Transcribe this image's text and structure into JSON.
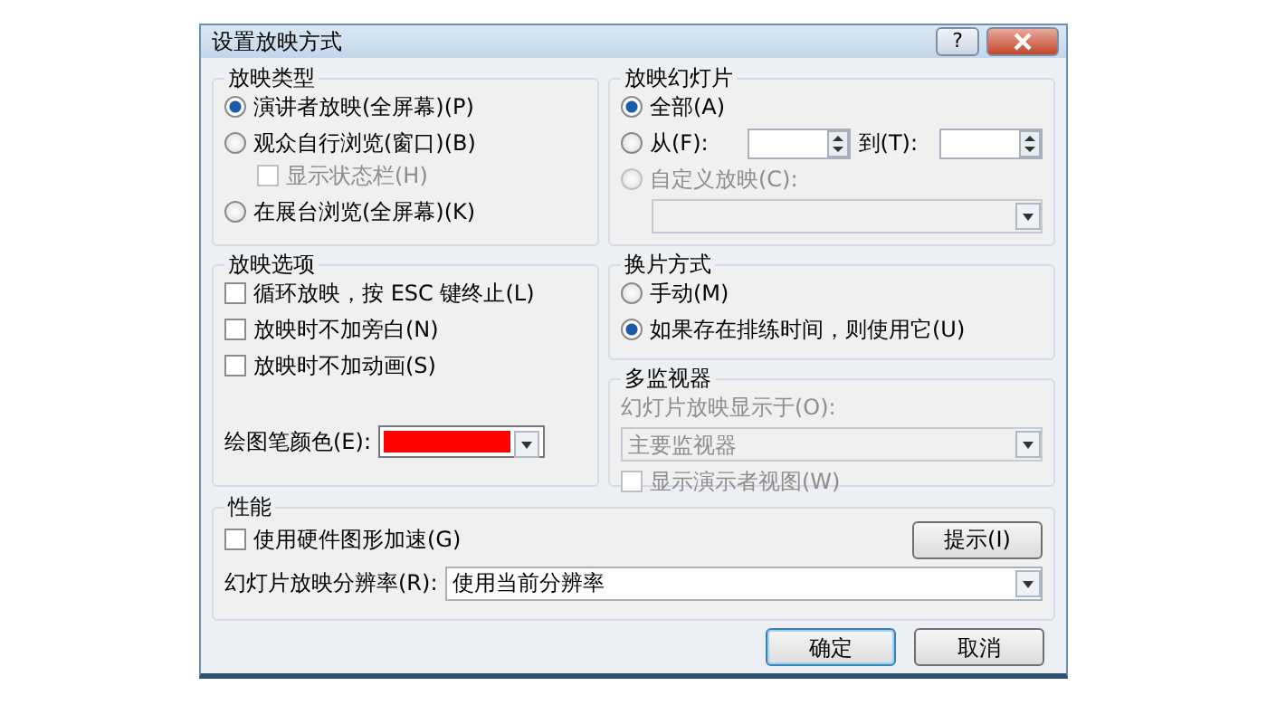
{
  "window": {
    "title": "设置放映方式",
    "help_button": "?"
  },
  "groups": [
    {
      "title": "放映类型",
      "items": [
        {
          "kind": "radio",
          "label": "演讲者放映(全屏幕)(P)",
          "selected": true,
          "disabled": false
        },
        {
          "kind": "radio",
          "label": "观众自行浏览(窗口)(B)",
          "selected": false,
          "disabled": false,
          "children": [
            {
              "kind": "checkbox",
              "label": "显示状态栏(H)",
              "checked": false,
              "disabled": true
            }
          ]
        },
        {
          "kind": "radio",
          "label": "在展台浏览(全屏幕)(K)",
          "selected": false,
          "disabled": false
        }
      ]
    },
    {
      "title": "放映幻灯片",
      "items": [
        {
          "kind": "radio",
          "label": "全部(A)",
          "selected": true,
          "disabled": false
        },
        {
          "kind": "range",
          "label": "从(F):",
          "to_label": "到(T):",
          "selected": false,
          "disabled": false
        },
        {
          "kind": "radio",
          "label": "自定义放映(C):",
          "selected": false,
          "disabled": true
        },
        {
          "kind": "dropdown",
          "disabled": true
        }
      ]
    },
    {
      "title": "放映选项",
      "items": [
        {
          "kind": "checkbox",
          "label": "循环放映，按 ESC 键终止(L)",
          "checked": false,
          "disabled": false
        },
        {
          "kind": "checkbox",
          "label": "放映时不加旁白(N)",
          "checked": false,
          "disabled": false
        },
        {
          "kind": "checkbox",
          "label": "放映时不加动画(S)",
          "checked": false,
          "disabled": false
        },
        {
          "kind": "color",
          "label": "绘图笔颜色(E):",
          "color": "#ff0000"
        }
      ]
    },
    {
      "title": "换片方式",
      "items": [
        {
          "kind": "radio",
          "label": "手动(M)",
          "selected": false,
          "disabled": false
        },
        {
          "kind": "radio",
          "label": "如果存在排练时间，则使用它(U)",
          "selected": true,
          "disabled": false
        }
      ]
    },
    {
      "title": "多监视器",
      "items": [
        {
          "kind": "label",
          "label": "幻灯片放映显示于(O):",
          "disabled": true
        },
        {
          "kind": "dropdown",
          "value": "主要监视器",
          "disabled": true
        },
        {
          "kind": "checkbox",
          "label": "显示演示者视图(W)",
          "checked": false,
          "disabled": true
        }
      ]
    },
    {
      "title": "性能",
      "items": [
        {
          "kind": "checkbox",
          "label": "使用硬件图形加速(G)",
          "checked": false,
          "disabled": false,
          "button": "提示(I)"
        },
        {
          "kind": "labeled-dropdown",
          "label": "幻灯片放映分辨率(R):",
          "value": "使用当前分辨率",
          "disabled": false
        }
      ]
    }
  ],
  "buttons": [
    {
      "label": "确定",
      "default": true
    },
    {
      "label": "取消",
      "default": false
    }
  ]
}
